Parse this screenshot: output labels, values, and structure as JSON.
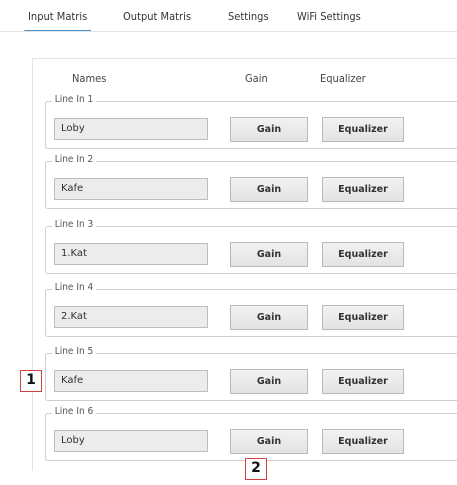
{
  "tabs": [
    {
      "label": "Input Matris",
      "active": true
    },
    {
      "label": "Output Matris",
      "active": false
    },
    {
      "label": "Settings",
      "active": false
    },
    {
      "label": "WiFi Settings",
      "active": false
    }
  ],
  "headers": {
    "names": "Names",
    "gain": "Gain",
    "equalizer": "Equalizer"
  },
  "lines": [
    {
      "label": "Line In 1",
      "name": "Loby",
      "gain_label": "Gain",
      "eq_label": "Equalizer"
    },
    {
      "label": "Line In 2",
      "name": "Kafe",
      "gain_label": "Gain",
      "eq_label": "Equalizer"
    },
    {
      "label": "Line In 3",
      "name": "1.Kat",
      "gain_label": "Gain",
      "eq_label": "Equalizer"
    },
    {
      "label": "Line In 4",
      "name": "2.Kat",
      "gain_label": "Gain",
      "eq_label": "Equalizer"
    },
    {
      "label": "Line In 5",
      "name": "Kafe",
      "gain_label": "Gain",
      "eq_label": "Equalizer"
    },
    {
      "label": "Line In 6",
      "name": "Loby",
      "gain_label": "Gain",
      "eq_label": "Equalizer"
    }
  ],
  "markers": {
    "one": "1",
    "two": "2"
  },
  "colors": {
    "active_tab": "#4a90c8",
    "marker_border": "#d04040"
  }
}
